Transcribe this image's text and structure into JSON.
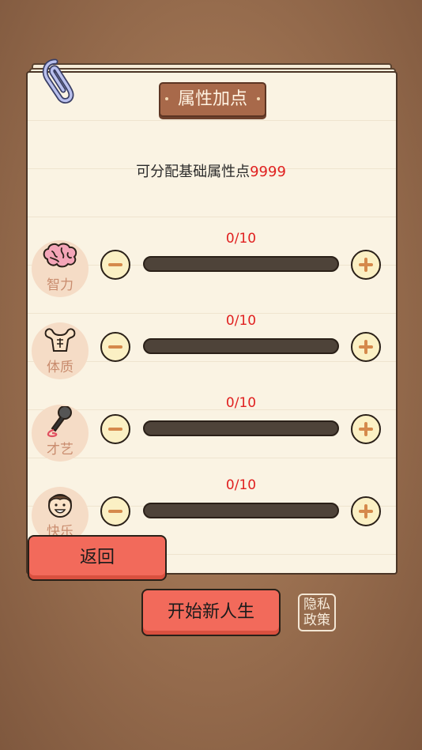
{
  "panel": {
    "title": "属性加点"
  },
  "points": {
    "label": "可分配基础属性点",
    "value": "9999"
  },
  "attributes": [
    {
      "label": "智力",
      "icon": "brain-icon",
      "current": 0,
      "max": 10,
      "display": "0/10"
    },
    {
      "label": "体质",
      "icon": "muscle-icon",
      "current": 0,
      "max": 10,
      "display": "0/10"
    },
    {
      "label": "才艺",
      "icon": "microphone-icon",
      "current": 0,
      "max": 10,
      "display": "0/10"
    },
    {
      "label": "快乐",
      "icon": "happy-face-icon",
      "current": 0,
      "max": 10,
      "display": "0/10"
    }
  ],
  "buttons": {
    "back": "返回",
    "start": "开始新人生",
    "privacy_line1": "隐私",
    "privacy_line2": "政策"
  },
  "colors": {
    "accent_red": "#f26a5b",
    "value_red": "#e02020",
    "track": "#4e4339",
    "button_face": "#fbf0c4"
  }
}
